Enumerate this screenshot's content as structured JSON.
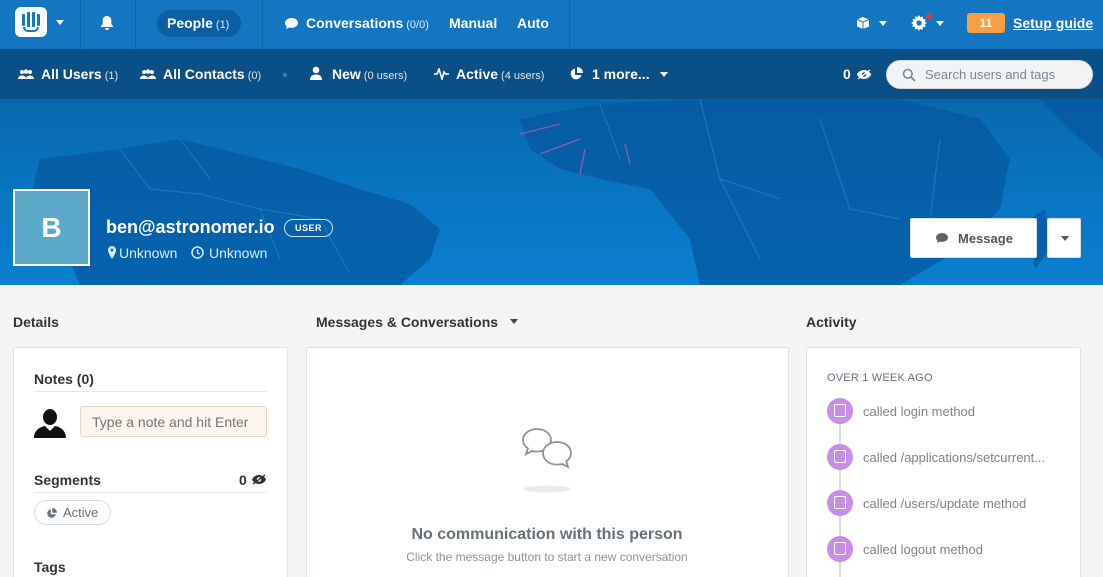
{
  "topnav": {
    "people_label": "People",
    "people_count": "(1)",
    "conversations_label": "Conversations",
    "conversations_count": "(0/0)",
    "manual_label": "Manual",
    "auto_label": "Auto",
    "setup_badge": "11",
    "setup_label": "Setup guide",
    "icons": [
      "intercom-logo-icon",
      "bell-icon",
      "chat-bubble-icon",
      "box-icon",
      "gear-icon"
    ]
  },
  "subnav": {
    "all_users_label": "All Users",
    "all_users_count": "(1)",
    "all_contacts_label": "All Contacts",
    "all_contacts_count": "(0)",
    "new_label": "New",
    "new_count": "(0 users)",
    "active_label": "Active",
    "active_count": "(4 users)",
    "more_label": "1 more...",
    "eye_count": "0",
    "search_placeholder": "Search users and tags"
  },
  "profile": {
    "avatar_letter": "B",
    "email": "ben@astronomer.io",
    "badge": "USER",
    "location": "Unknown",
    "timezone": "Unknown",
    "message_button": "Message"
  },
  "details": {
    "column_title": "Details",
    "notes_title": "Notes (0)",
    "note_placeholder": "Type a note and hit Enter",
    "segments_title": "Segments",
    "segments_count": "0",
    "segment_pill": "Active",
    "tags_title": "Tags"
  },
  "messages": {
    "column_title": "Messages & Conversations",
    "empty_title": "No communication with this person",
    "empty_subtitle": "Click the message button to start a new conversation"
  },
  "activity": {
    "column_title": "Activity",
    "group_label": "OVER 1 WEEK AGO",
    "items": [
      {
        "label": "called login method"
      },
      {
        "label": "called /applications/setcurrent..."
      },
      {
        "label": "called /users/update method"
      },
      {
        "label": "called logout method"
      }
    ]
  },
  "colors": {
    "topnav": "#1475c0",
    "subnav": "#0a4f86",
    "accent_orange": "#f7a040",
    "activity_purple": "#c88ee6",
    "avatar": "#5ca8c8"
  }
}
